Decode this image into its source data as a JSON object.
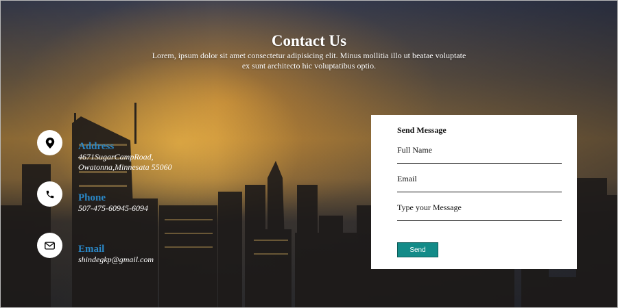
{
  "header": {
    "title": "Contact Us",
    "description": "Lorem, ipsum dolor sit amet consectetur adipisicing elit. Minus mollitia illo ut beatae voluptate ex sunt architecto hic voluptatibus optio."
  },
  "contact_info": [
    {
      "icon": "location-pin-icon",
      "title": "Address",
      "value": "4671SugarCampRoad, Owatonna,Minnesata 55060"
    },
    {
      "icon": "phone-icon",
      "title": "Phone",
      "value": "507-475-60945-6094"
    },
    {
      "icon": "envelope-icon",
      "title": "Email",
      "value": "shindegkp@gmail.com"
    }
  ],
  "form": {
    "title": "Send Message",
    "fields": [
      {
        "label": "Full Name",
        "value": ""
      },
      {
        "label": "Email",
        "value": ""
      },
      {
        "label": "Type your Message",
        "value": ""
      }
    ],
    "submit_label": "Send"
  },
  "colors": {
    "accent_title": "#2a86c4",
    "button": "#138b88"
  }
}
